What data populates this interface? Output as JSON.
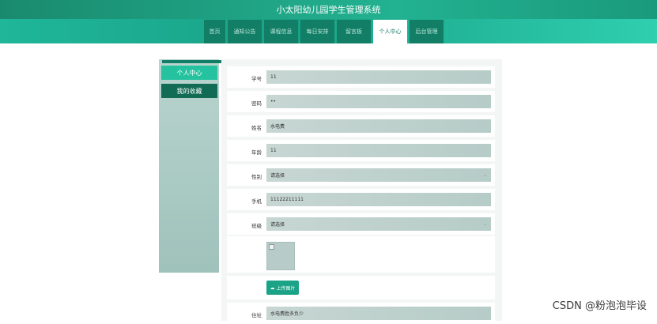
{
  "header": {
    "title": "小太阳幼儿园学生管理系统"
  },
  "nav": {
    "items": [
      {
        "label": "首页",
        "active": false
      },
      {
        "label": "通知公告",
        "active": false
      },
      {
        "label": "课程信息",
        "active": false
      },
      {
        "label": "每日安排",
        "active": false
      },
      {
        "label": "留言板",
        "active": false
      },
      {
        "label": "个人中心",
        "active": true
      },
      {
        "label": "后台管理",
        "active": false
      }
    ]
  },
  "sidebar": {
    "items": [
      {
        "label": "个人中心",
        "active": true
      },
      {
        "label": "我的收藏",
        "active": false
      }
    ]
  },
  "form": {
    "student_id": {
      "label": "学号",
      "value": "11"
    },
    "password": {
      "label": "密码",
      "value": "••"
    },
    "name": {
      "label": "姓名",
      "value": "水电费"
    },
    "age": {
      "label": "年龄",
      "value": "11"
    },
    "gender": {
      "label": "性别",
      "placeholder": "请选择"
    },
    "phone": {
      "label": "手机",
      "value": "11122211111"
    },
    "class": {
      "label": "班级",
      "placeholder": "请选择"
    },
    "upload_label": "上传图片",
    "address": {
      "label": "住址",
      "value": "水电费胜多负少"
    }
  },
  "watermark": "CSDN @粉泡泡毕设",
  "colors": {
    "primary": "#1aa386",
    "dark": "#137e66",
    "field": "#c2d3cf"
  }
}
